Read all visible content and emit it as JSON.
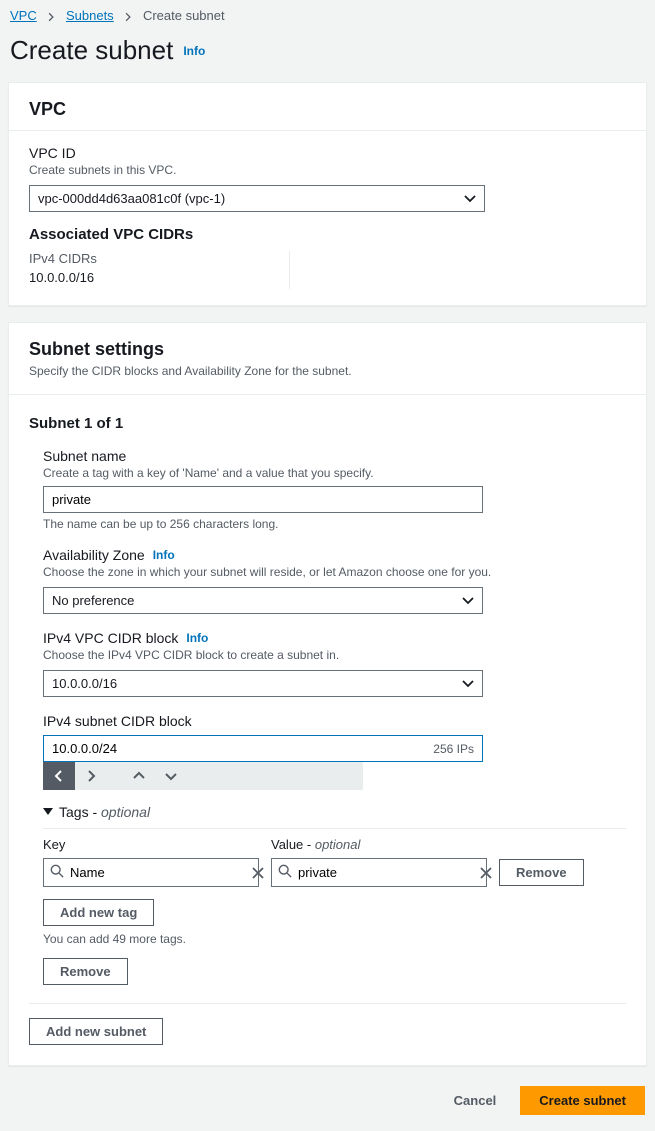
{
  "breadcrumb": {
    "vpc": "VPC",
    "subnets": "Subnets",
    "current": "Create subnet"
  },
  "page": {
    "title": "Create subnet",
    "info": "Info"
  },
  "vpc_panel": {
    "title": "VPC",
    "vpc_id_label": "VPC ID",
    "vpc_id_desc": "Create subnets in this VPC.",
    "vpc_selected": "vpc-000dd4d63aa081c0f (vpc-1)",
    "assoc_title": "Associated VPC CIDRs",
    "ipv4_header": "IPv4 CIDRs",
    "ipv4_value": "10.0.0.0/16"
  },
  "subnet_panel": {
    "title": "Subnet settings",
    "subtitle": "Specify the CIDR blocks and Availability Zone for the subnet.",
    "counter": "Subnet 1 of 1",
    "name": {
      "label": "Subnet name",
      "desc": "Create a tag with a key of 'Name' and a value that you specify.",
      "value": "private",
      "help": "The name can be up to 256 characters long."
    },
    "az": {
      "label": "Availability Zone",
      "info": "Info",
      "desc": "Choose the zone in which your subnet will reside, or let Amazon choose one for you.",
      "value": "No preference"
    },
    "ipv4_vpc_block": {
      "label": "IPv4 VPC CIDR block",
      "info": "Info",
      "desc": "Choose the IPv4 VPC CIDR block to create a subnet in.",
      "value": "10.0.0.0/16"
    },
    "ipv4_subnet_block": {
      "label": "IPv4 subnet CIDR block",
      "value": "10.0.0.0/24",
      "suffix": "256 IPs"
    },
    "tags": {
      "toggle": "Tags - ",
      "toggle_optional": "optional",
      "key_header": "Key",
      "value_header": "Value - ",
      "value_optional": "optional",
      "key_value": "Name",
      "val_value": "private",
      "remove": "Remove",
      "add": "Add new tag",
      "limit": "You can add 49 more tags."
    },
    "remove_subnet": "Remove",
    "add_subnet": "Add new subnet"
  },
  "footer": {
    "cancel": "Cancel",
    "submit": "Create subnet"
  }
}
